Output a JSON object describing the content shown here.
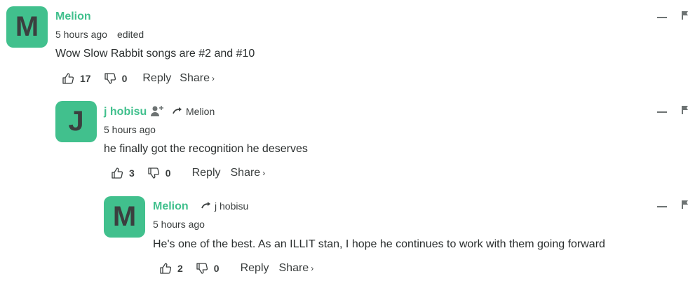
{
  "comments": [
    {
      "avatar_letter": "M",
      "author": "Melion",
      "time": "5 hours ago",
      "edited": "edited",
      "text": "Wow Slow Rabbit songs are #2 and #10",
      "likes": "17",
      "dislikes": "0",
      "reply_label": "Reply",
      "share_label": "Share"
    },
    {
      "avatar_letter": "J",
      "author": "j hobisu",
      "reply_to": "Melion",
      "time": "5 hours ago",
      "text": "he finally got the recognition he deserves",
      "likes": "3",
      "dislikes": "0",
      "reply_label": "Reply",
      "share_label": "Share"
    },
    {
      "avatar_letter": "M",
      "author": "Melion",
      "reply_to": "j hobisu",
      "time": "5 hours ago",
      "text": "He's one of the best. As an ILLIT stan, I hope he continues to work with them going forward",
      "likes": "2",
      "dislikes": "0",
      "reply_label": "Reply",
      "share_label": "Share"
    }
  ],
  "colors": {
    "accent": "#41c08d",
    "text": "#2a2e2e",
    "muted": "#3a3e3e",
    "icon": "#6d7373"
  },
  "icons": {
    "like": "thumbs-up-icon",
    "dislike": "thumbs-down-icon",
    "collapse": "minus-icon",
    "flag": "flag-icon",
    "follow": "add-user-icon",
    "reply_arrow": "reply-arrow-icon",
    "share_chevron": "chevron-right-icon"
  }
}
